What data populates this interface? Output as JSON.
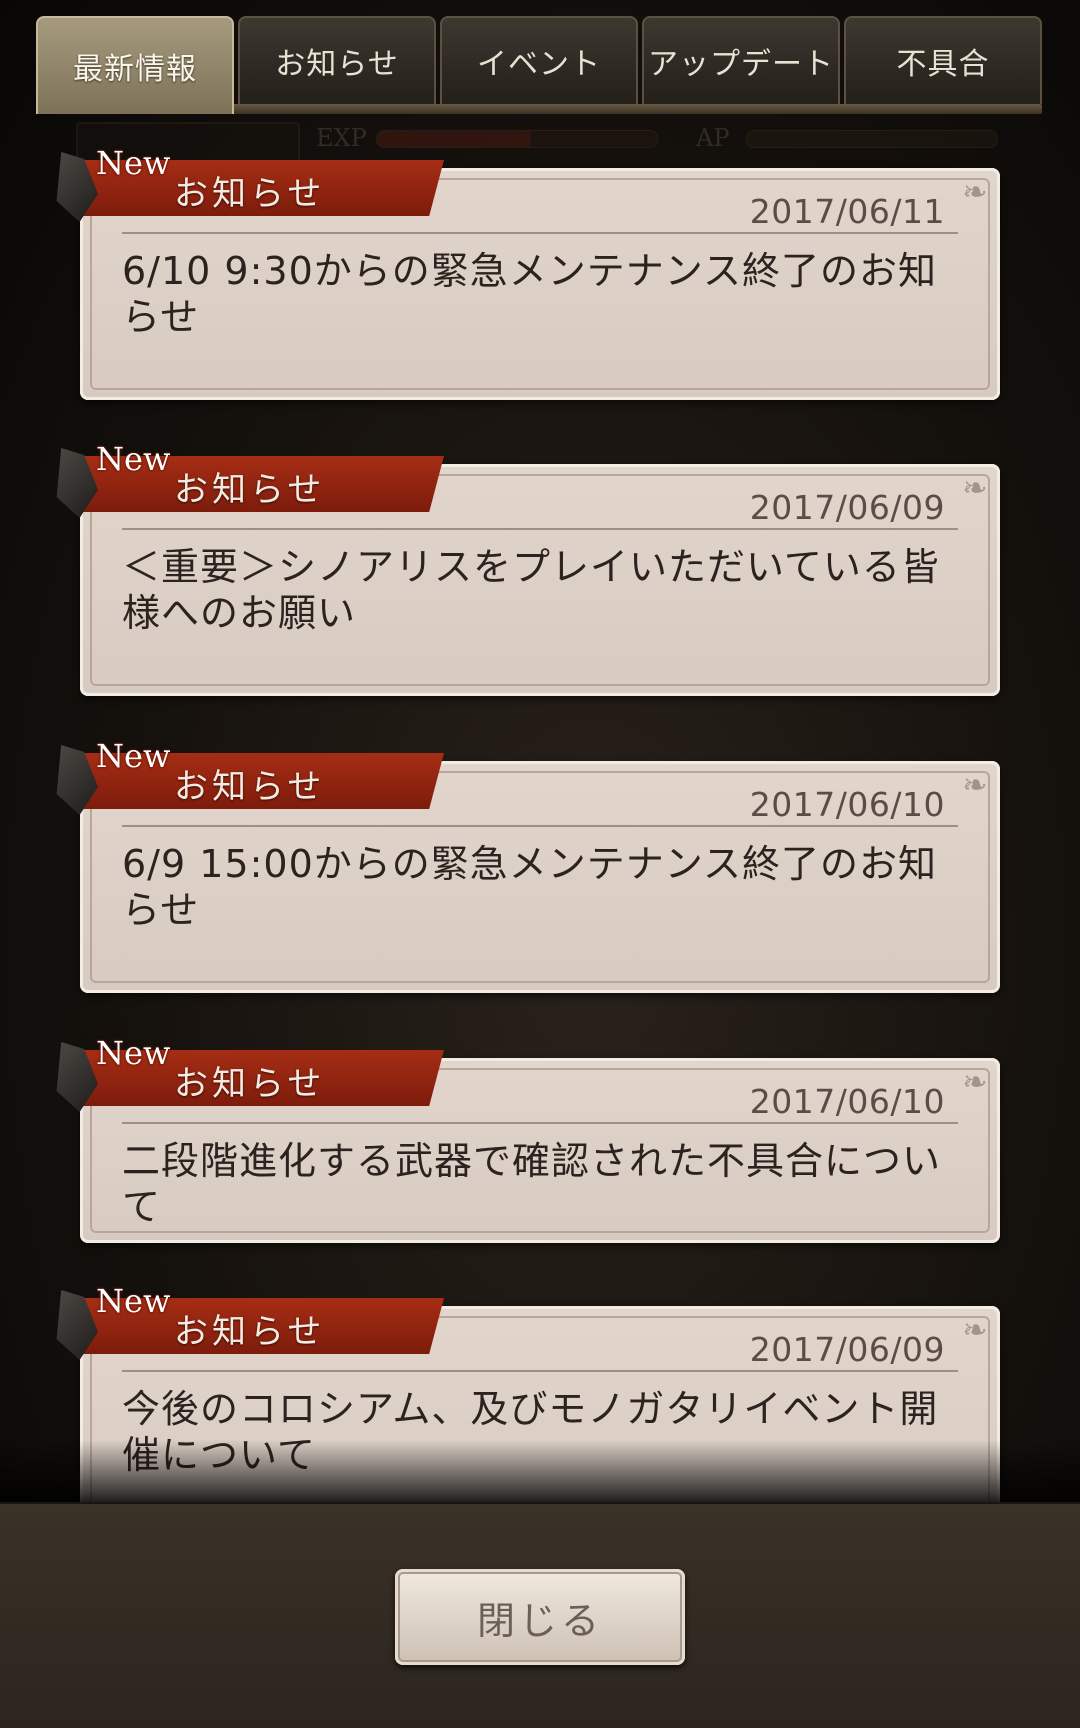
{
  "tabs": [
    {
      "label": "最新情報",
      "active": true
    },
    {
      "label": "お知らせ",
      "active": false
    },
    {
      "label": "イベント",
      "active": false
    },
    {
      "label": "アップデート",
      "active": false
    },
    {
      "label": "不具合",
      "active": false
    }
  ],
  "notices": [
    {
      "badge": "New",
      "category": "お知らせ",
      "date": "2017/06/11",
      "title": "6/10 9:30からの緊急メンテナンス終了のお知らせ"
    },
    {
      "badge": "New",
      "category": "お知らせ",
      "date": "2017/06/09",
      "title": "＜重要＞シノアリスをプレイいただいている皆様へのお願い"
    },
    {
      "badge": "New",
      "category": "お知らせ",
      "date": "2017/06/10",
      "title": "6/9 15:00からの緊急メンテナンス終了のお知らせ"
    },
    {
      "badge": "New",
      "category": "お知らせ",
      "date": "2017/06/10",
      "title": "二段階進化する武器で確認された不具合について"
    },
    {
      "badge": "New",
      "category": "お知らせ",
      "date": "2017/06/09",
      "title": "今後のコロシアム、及びモノガタリイベント開催について"
    }
  ],
  "background_hud": {
    "exp_label": "EXP",
    "ap_label": "AP"
  },
  "close_button": {
    "label": "閉じる"
  },
  "colors": {
    "ribbon": "#a62d14",
    "card": "#e2d6cc",
    "active_tab": "#a69a7e"
  }
}
